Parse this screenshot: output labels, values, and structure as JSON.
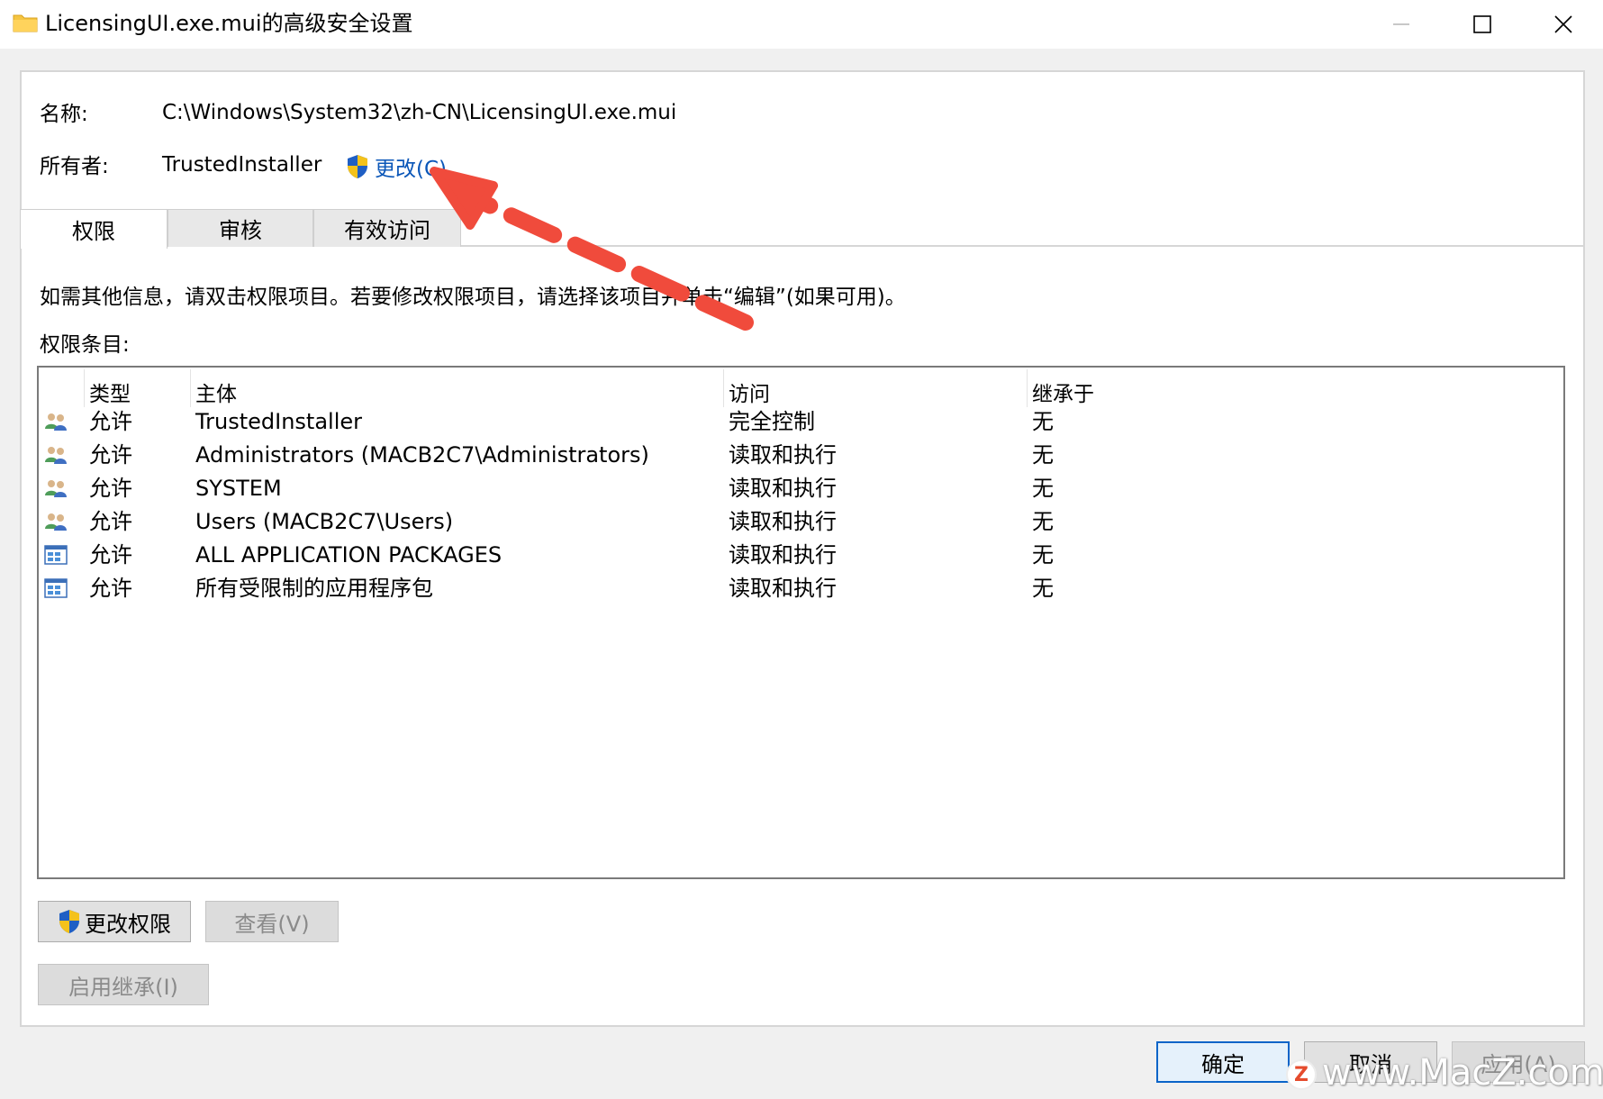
{
  "window": {
    "title": "LicensingUI.exe.mui的高级安全设置",
    "icon": "folder-icon",
    "controls": [
      "minimize-icon",
      "maximize-icon",
      "close-icon"
    ]
  },
  "info": {
    "name_label": "名称:",
    "name_value": "C:\\Windows\\System32\\zh-CN\\LicensingUI.exe.mui",
    "owner_label": "所有者:",
    "owner_value": "TrustedInstaller",
    "change_link": "更改(C)"
  },
  "tabs": [
    {
      "label": "权限",
      "active": true
    },
    {
      "label": "审核",
      "active": false
    },
    {
      "label": "有效访问",
      "active": false
    }
  ],
  "description": "如需其他信息，请双击权限项目。若要修改权限项目，请选择该项目并单击“编辑”(如果可用)。",
  "entries_label": "权限条目:",
  "table": {
    "columns": [
      "类型",
      "主体",
      "访问",
      "继承于"
    ],
    "rows": [
      {
        "icon": "user-group-icon",
        "type": "允许",
        "principal": "TrustedInstaller",
        "access": "完全控制",
        "inherited": "无"
      },
      {
        "icon": "user-group-icon",
        "type": "允许",
        "principal": "Administrators (MACB2C7\\Administrators)",
        "access": "读取和执行",
        "inherited": "无"
      },
      {
        "icon": "user-group-icon",
        "type": "允许",
        "principal": "SYSTEM",
        "access": "读取和执行",
        "inherited": "无"
      },
      {
        "icon": "user-group-icon",
        "type": "允许",
        "principal": "Users (MACB2C7\\Users)",
        "access": "读取和执行",
        "inherited": "无"
      },
      {
        "icon": "app-package-icon",
        "type": "允许",
        "principal": "ALL APPLICATION PACKAGES",
        "access": "读取和执行",
        "inherited": "无"
      },
      {
        "icon": "app-package-icon",
        "type": "允许",
        "principal": "所有受限制的应用程序包",
        "access": "读取和执行",
        "inherited": "无"
      }
    ]
  },
  "buttons": {
    "change_permissions": "更改权限",
    "view": "查看(V)",
    "enable_inheritance": "启用继承(I)",
    "ok": "确定",
    "cancel": "取消",
    "apply": "应用(A)"
  },
  "watermark": {
    "logo": "Z",
    "text": "www.MacZ.com"
  },
  "colors": {
    "link": "#0a56b8",
    "annotation_arrow": "#f04b3c",
    "primary_border": "#0a64c8"
  }
}
